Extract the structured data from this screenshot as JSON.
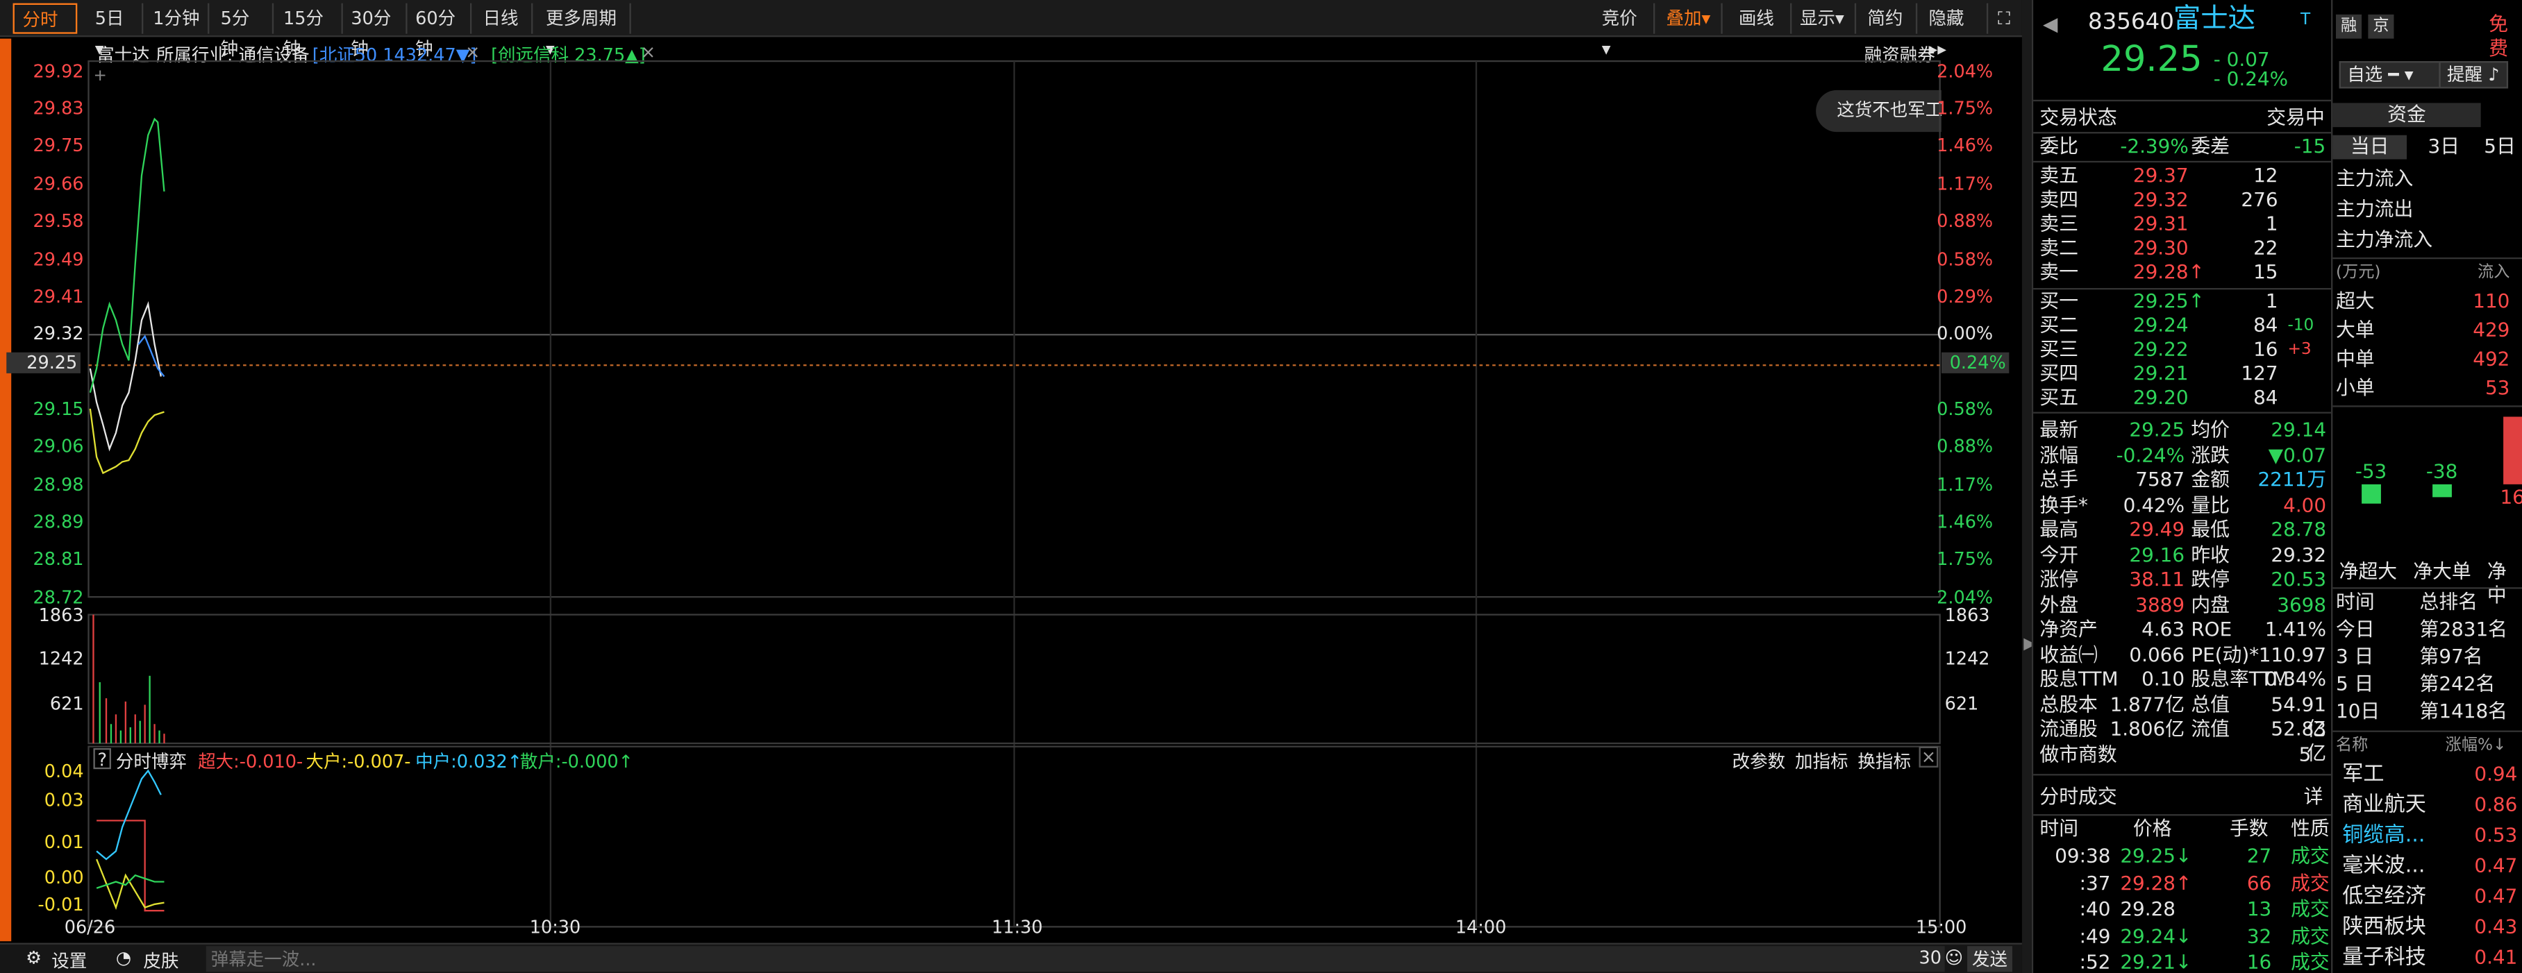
{
  "toolbar": {
    "items": [
      "分时",
      "5日",
      "1分钟",
      "5分钟",
      "15分钟",
      "30分钟",
      "60分钟",
      "日线",
      "更多周期"
    ],
    "right": [
      "竞价",
      "叠加",
      "画线",
      "显示",
      "简约",
      "隐藏"
    ]
  },
  "header": {
    "stock": "富士达",
    "industry": "所属行业: 通信设备",
    "idx1": "[北证50 1432.47▼]",
    "idx2": "[创远信科 23.75▲]",
    "margin": "融资融券",
    "tooltip": "这货不也军工"
  },
  "price_axis": {
    "left": [
      "29.92",
      "29.83",
      "29.75",
      "29.66",
      "29.58",
      "29.49",
      "29.41",
      "29.32",
      "29.25",
      "29.15",
      "29.06",
      "28.98",
      "28.89",
      "28.81",
      "28.72"
    ],
    "right": [
      "2.04%",
      "1.75%",
      "1.46%",
      "1.17%",
      "0.88%",
      "0.58%",
      "0.29%",
      "0.00%",
      "0.24%",
      "0.58%",
      "0.88%",
      "1.17%",
      "1.46%",
      "1.75%",
      "2.04%"
    ],
    "current": "29.25",
    "current_pct": "0.24%"
  },
  "vol_axis": {
    "labels": [
      "1863",
      "1242",
      "621"
    ]
  },
  "ind": {
    "q": "?",
    "title": "分时博弈",
    "cd": "超大:-0.010-",
    "dh": "大户:-0.007-",
    "zh": "中户:0.032↑",
    "sh": "散户:-0.000↑",
    "btns": [
      "改参数",
      "加指标",
      "换指标"
    ],
    "axis": [
      "0.04",
      "0.03",
      "0.01",
      "0.00",
      "-0.01"
    ]
  },
  "time_axis": [
    "06/26",
    "10:30",
    "11:30",
    "14:00",
    "15:00"
  ],
  "status": {
    "settings": "设置",
    "skin": "皮肤",
    "placeholder": "弹幕走一波...",
    "count": "30",
    "send": "发送"
  },
  "quote": {
    "code": "835640",
    "name": "富士达",
    "t": "T",
    "price": "29.25",
    "chg": "- 0.07",
    "pct": "- 0.24%",
    "b1": "融",
    "b2": "京",
    "optional": "自选",
    "alert": "提醒",
    "state_label": "交易状态",
    "state": "交易中",
    "wb": "委比",
    "wb_v": "-2.39%",
    "wc": "委差",
    "wc_v": "-15",
    "asks": [
      {
        "n": "卖五",
        "p": "29.37",
        "v": "12"
      },
      {
        "n": "卖四",
        "p": "29.32",
        "v": "276"
      },
      {
        "n": "卖三",
        "p": "29.31",
        "v": "1"
      },
      {
        "n": "卖二",
        "p": "29.30",
        "v": "22"
      },
      {
        "n": "卖一",
        "p": "29.28↑",
        "v": "15"
      }
    ],
    "bids": [
      {
        "n": "买一",
        "p": "29.25↑",
        "v": "1",
        "d": ""
      },
      {
        "n": "买二",
        "p": "29.24",
        "v": "84",
        "d": "-10"
      },
      {
        "n": "买三",
        "p": "29.22",
        "v": "16",
        "d": "+3"
      },
      {
        "n": "买四",
        "p": "29.21",
        "v": "127",
        "d": ""
      },
      {
        "n": "买五",
        "p": "29.20",
        "v": "84",
        "d": ""
      }
    ],
    "stats": [
      [
        "最新",
        "29.25",
        "均价",
        "29.14"
      ],
      [
        "涨幅",
        "-0.24%",
        "涨跌",
        "▼0.07"
      ],
      [
        "总手",
        "7587",
        "金额",
        "2211万"
      ],
      [
        "换手*",
        "0.42%",
        "量比",
        "4.00"
      ],
      [
        "最高",
        "29.49",
        "最低",
        "28.78"
      ],
      [
        "今开",
        "29.16",
        "昨收",
        "29.32"
      ],
      [
        "涨停",
        "38.11",
        "跌停",
        "20.53"
      ],
      [
        "外盘",
        "3889",
        "内盘",
        "3698"
      ],
      [
        "净资产",
        "4.63",
        "ROE",
        "1.41%"
      ],
      [
        "收益㈠",
        "0.066",
        "PE(动)*",
        "110.97"
      ],
      [
        "股息TTM",
        "0.10",
        "股息率TTM",
        "0.34%"
      ],
      [
        "总股本",
        "1.877亿",
        "总值",
        "54.91亿"
      ],
      [
        "流通股",
        "1.806亿",
        "流值",
        "52.83亿"
      ]
    ],
    "mm": "做市商数",
    "mm_v": "5",
    "trades_title": "分时成交",
    "trades_btn": "详",
    "trades_hdr": [
      "时间",
      "价格",
      "手数",
      "性质"
    ],
    "trades": [
      [
        "09:38",
        "29.25↓",
        "27",
        "成交"
      ],
      [
        ":37",
        "29.28↑",
        "66",
        "成交"
      ],
      [
        ":40",
        "29.28",
        "13",
        "成交"
      ],
      [
        ":49",
        "29.24↓",
        "32",
        "成交"
      ],
      [
        ":52",
        "29.21↓",
        "16",
        "成交"
      ]
    ]
  },
  "fund": {
    "free": "免费",
    "tab": "资金",
    "tabs": [
      "当日",
      "3日",
      "5日"
    ],
    "flows": [
      "主力流入",
      "主力流出",
      "主力净流入"
    ],
    "unit": "(万元)",
    "in": "流入",
    "rows": [
      [
        "超大",
        "110"
      ],
      [
        "大单",
        "429"
      ],
      [
        "中单",
        "492"
      ],
      [
        "小单",
        "53"
      ]
    ],
    "bars": [
      "-53",
      "-38",
      "16"
    ],
    "netlbl": [
      "净超大",
      "净大单",
      "净中"
    ],
    "rank_hdr": [
      "时间",
      "总排名"
    ],
    "ranks": [
      [
        "今日",
        "第2831名"
      ],
      [
        "3 日",
        "第97名"
      ],
      [
        "5 日",
        "第242名"
      ],
      [
        "10日",
        "第1418名"
      ]
    ],
    "sec_hdr": [
      "名称",
      "涨幅%"
    ],
    "sectors": [
      [
        "军工",
        "0.94"
      ],
      [
        "商业航天",
        "0.86"
      ],
      [
        "铜缆高...",
        "0.53"
      ],
      [
        "毫米波...",
        "0.47"
      ],
      [
        "低空经济",
        "0.47"
      ],
      [
        "陕西板块",
        "0.43"
      ],
      [
        "量子科技",
        "0.41"
      ]
    ]
  }
}
